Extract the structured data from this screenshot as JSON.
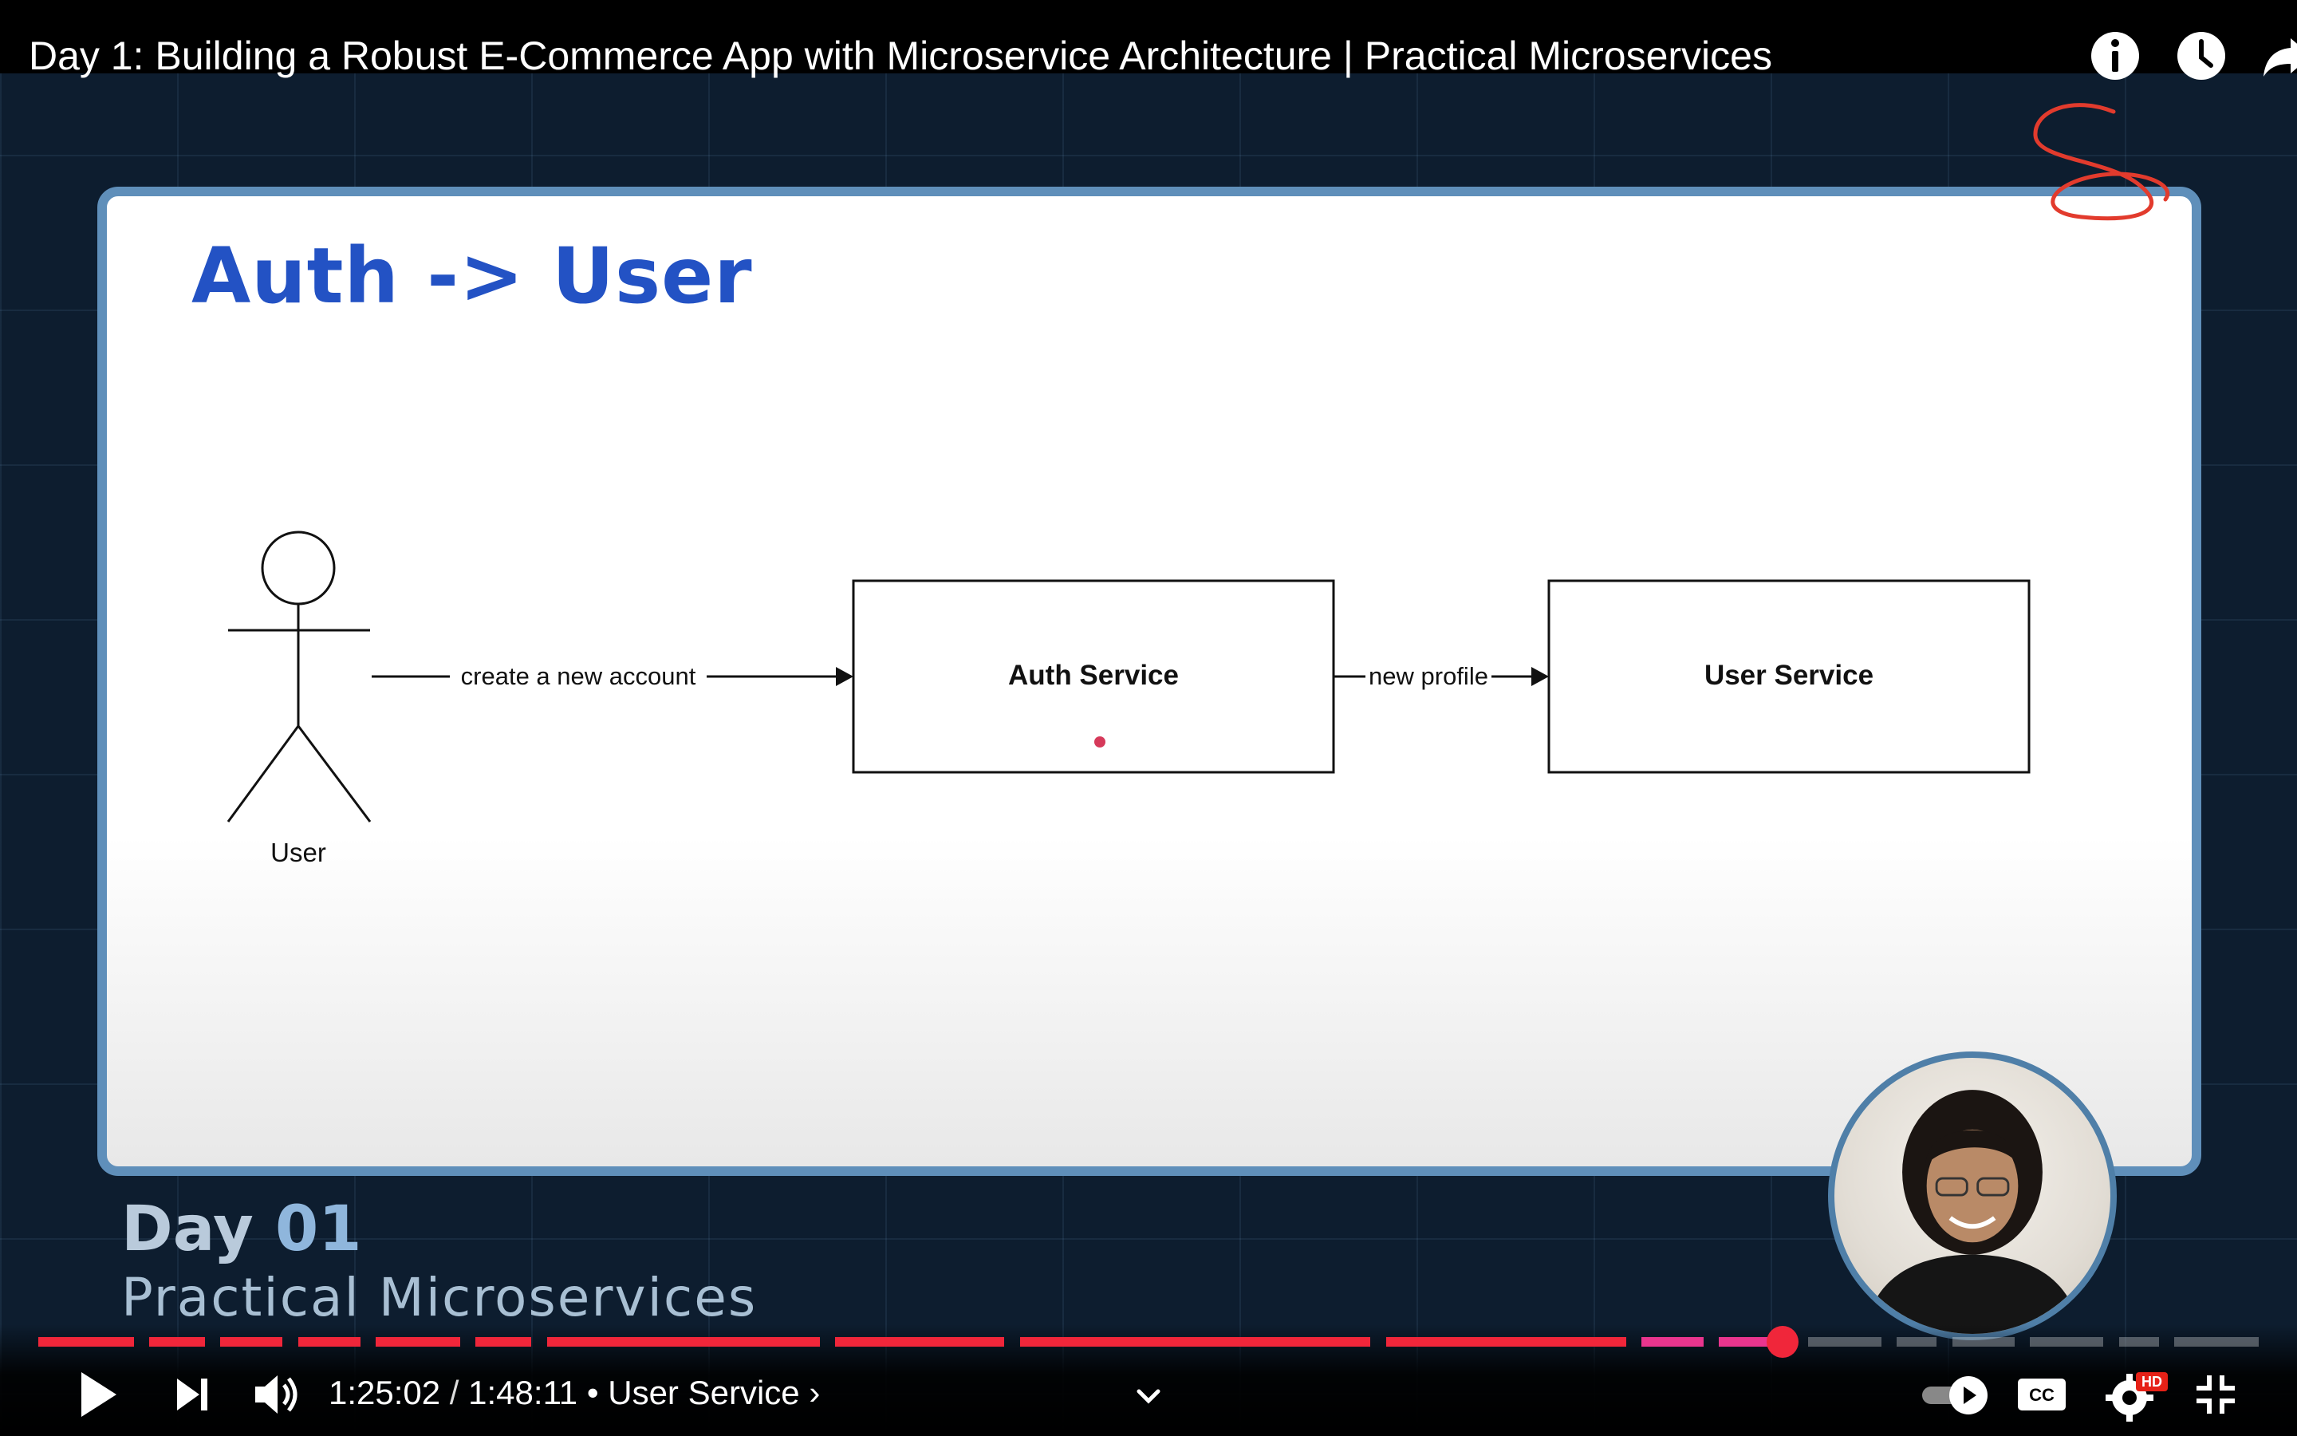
{
  "video": {
    "title": "Day 1: Building a Robust E-Commerce App with Microservice Architecture | Practical Microservices"
  },
  "top_actions": [
    {
      "name": "info-icon"
    },
    {
      "name": "watch-later-icon"
    },
    {
      "name": "share-icon"
    }
  ],
  "slide": {
    "title": "Auth -> User",
    "actor_label": "User",
    "edge1_label": "create a new account",
    "box1_label": "Auth Service",
    "edge2_label": "new profile",
    "box2_label": "User Service"
  },
  "lower_third": {
    "day_word": "Day",
    "day_num": "01",
    "course": "Practical Microservices"
  },
  "player": {
    "current_time": "1:25:02",
    "separator": " / ",
    "duration": "1:48:11",
    "chapter_prefix": "•",
    "chapter": "User Service",
    "chapter_chevron": "›",
    "progress_fraction": 0.7854,
    "played_color": "#f0263a",
    "accent_color": "#e9358e",
    "quality_badge": "HD",
    "autoplay_on": true
  },
  "colors": {
    "slide_border": "#5f8fba",
    "slide_title": "#2352c4",
    "background": "#0d1d2f"
  }
}
